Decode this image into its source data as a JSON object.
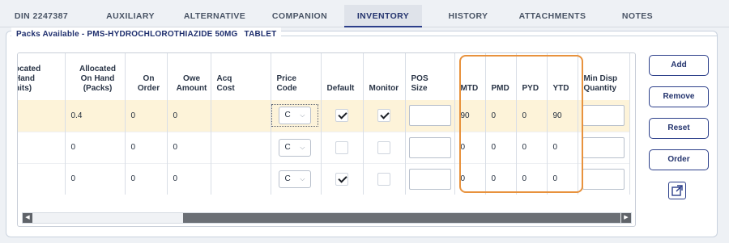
{
  "tabs": [
    {
      "label": "DIN 2247387"
    },
    {
      "label": "AUXILIARY"
    },
    {
      "label": "ALTERNATIVE"
    },
    {
      "label": "COMPANION"
    },
    {
      "label": "INVENTORY"
    },
    {
      "label": "HISTORY"
    },
    {
      "label": "ATTACHMENTS"
    },
    {
      "label": "NOTES"
    }
  ],
  "active_tab": "INVENTORY",
  "section": {
    "title": "Packs Available - PMS-HYDROCHLOROTHIAZIDE 50MG",
    "pack_type": "TABLET"
  },
  "grid": {
    "headers": {
      "alloc_units": "ocated\nHand\nnits)",
      "alloc_packs": "Allocated\nOn Hand\n(Packs)",
      "on_order": "On\nOrder",
      "owe_amount": "Owe\nAmount",
      "acq_cost": "Acq\nCost",
      "price_code": "Price\nCode",
      "default": "Default",
      "monitor": "Monitor",
      "pos_size": "POS\nSize",
      "mtd": "MTD",
      "pmd": "PMD",
      "pyd": "PYD",
      "ytd": "YTD",
      "min_disp": "Min Disp\nQuantity"
    },
    "rows": [
      {
        "alloc_packs": "0.4",
        "on_order": "0",
        "owe_amount": "0",
        "price_code": "C",
        "default": true,
        "monitor": true,
        "mtd": "90",
        "pmd": "0",
        "pyd": "0",
        "ytd": "90"
      },
      {
        "alloc_packs": "0",
        "on_order": "0",
        "owe_amount": "0",
        "price_code": "C",
        "default": false,
        "monitor": false,
        "mtd": "0",
        "pmd": "0",
        "pyd": "0",
        "ytd": "0"
      },
      {
        "alloc_packs": "0",
        "on_order": "0",
        "owe_amount": "0",
        "price_code": "C",
        "default": true,
        "monitor": false,
        "mtd": "0",
        "pmd": "0",
        "pyd": "0",
        "ytd": "0"
      }
    ],
    "highlight_color": "#e8923d",
    "selected_row_color": "#fdf3d9"
  },
  "buttons": {
    "add": "Add",
    "remove": "Remove",
    "reset": "Reset",
    "order": "Order"
  },
  "icons": {
    "expand": "open-in-new-icon",
    "scroll_left": "chevron-left-icon",
    "scroll_right": "chevron-right-icon"
  },
  "colors": {
    "accent": "#2c3f8a",
    "highlight": "#e8923d"
  }
}
